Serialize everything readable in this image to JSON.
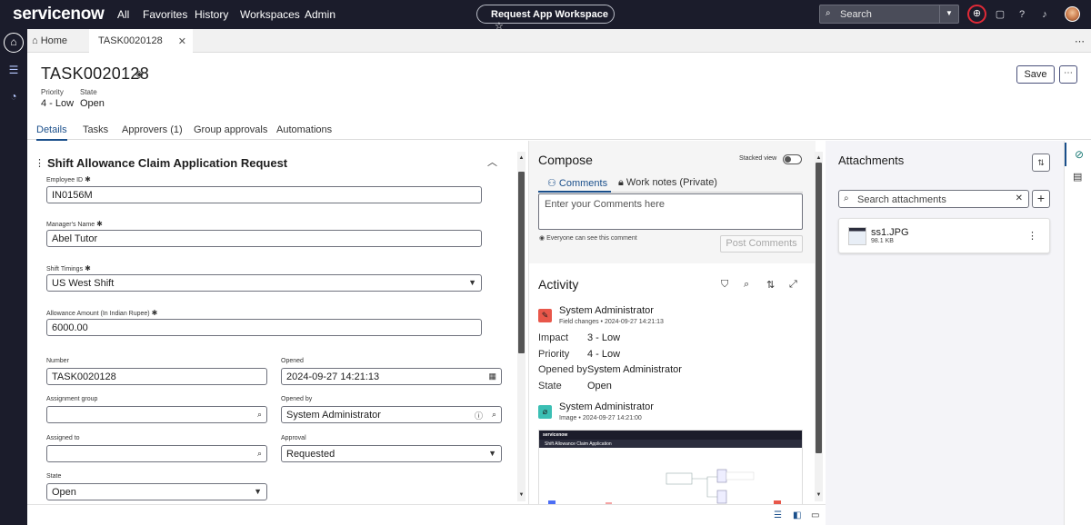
{
  "top_nav": {
    "brand": "servicenow",
    "links": [
      "All",
      "Favorites",
      "History",
      "Workspaces",
      "Admin"
    ],
    "workspace_pill": "Request App Workspace",
    "search_placeholder": "Search"
  },
  "tabs": {
    "home": "Home",
    "record": "TASK0020128"
  },
  "header": {
    "title": "TASK0020128",
    "priority_label": "Priority",
    "priority_value": "4 - Low",
    "state_label": "State",
    "state_value": "Open",
    "save_label": "Save"
  },
  "subtabs": [
    "Details",
    "Tasks",
    "Approvers (1)",
    "Group approvals",
    "Automations"
  ],
  "form": {
    "section_title": "Shift Allowance Claim Application Request",
    "employee_id_label": "Employee ID",
    "employee_id_value": "IN0156M",
    "manager_label": "Manager's Name",
    "manager_value": "Abel Tutor",
    "shift_label": "Shift Timings",
    "shift_value": "US West Shift",
    "allowance_label": "Allowance Amount (In Indian Rupee)",
    "allowance_value": "6000.00",
    "number_label": "Number",
    "number_value": "TASK0020128",
    "opened_label": "Opened",
    "opened_value": "2024-09-27 14:21:13",
    "assignment_group_label": "Assignment group",
    "assignment_group_value": "",
    "opened_by_label": "Opened by",
    "opened_by_value": "System Administrator",
    "assigned_to_label": "Assigned to",
    "assigned_to_value": "",
    "approval_label": "Approval",
    "approval_value": "Requested",
    "state_label": "State",
    "state_value": "Open",
    "required_mark": "✱"
  },
  "compose": {
    "title": "Compose",
    "stacked_view_label": "Stacked view",
    "tab_comments": "Comments",
    "tab_work_notes": "Work notes (Private)",
    "comment_placeholder": "Enter your Comments here",
    "visibility_note": "Everyone can see this comment",
    "post_label": "Post Comments"
  },
  "activity": {
    "title": "Activity",
    "entries": [
      {
        "author": "System Administrator",
        "type": "Field changes",
        "timestamp": "2024-09-27 14:21:13",
        "badge_color": "#e8574a",
        "fields": [
          {
            "key": "Impact",
            "value": "3 - Low"
          },
          {
            "key": "Priority",
            "value": "4 - Low"
          },
          {
            "key": "Opened by",
            "value": "System Administrator"
          },
          {
            "key": "State",
            "value": "Open"
          }
        ]
      },
      {
        "author": "System Administrator",
        "type": "Image",
        "timestamp": "2024-09-27 14:21:00",
        "badge_color": "#3bbfb4"
      }
    ],
    "image_preview_title": "Shift Allowance Claim Application"
  },
  "attachments": {
    "title": "Attachments",
    "search_placeholder": "Search attachments",
    "files": [
      {
        "name": "ss1.JPG",
        "size": "98.1 KB"
      }
    ]
  },
  "colors": {
    "nav_bg": "#1b1c2b",
    "accent": "#1a4f8b",
    "brand_green": "#62d84e",
    "alert_red": "#e02a37"
  }
}
